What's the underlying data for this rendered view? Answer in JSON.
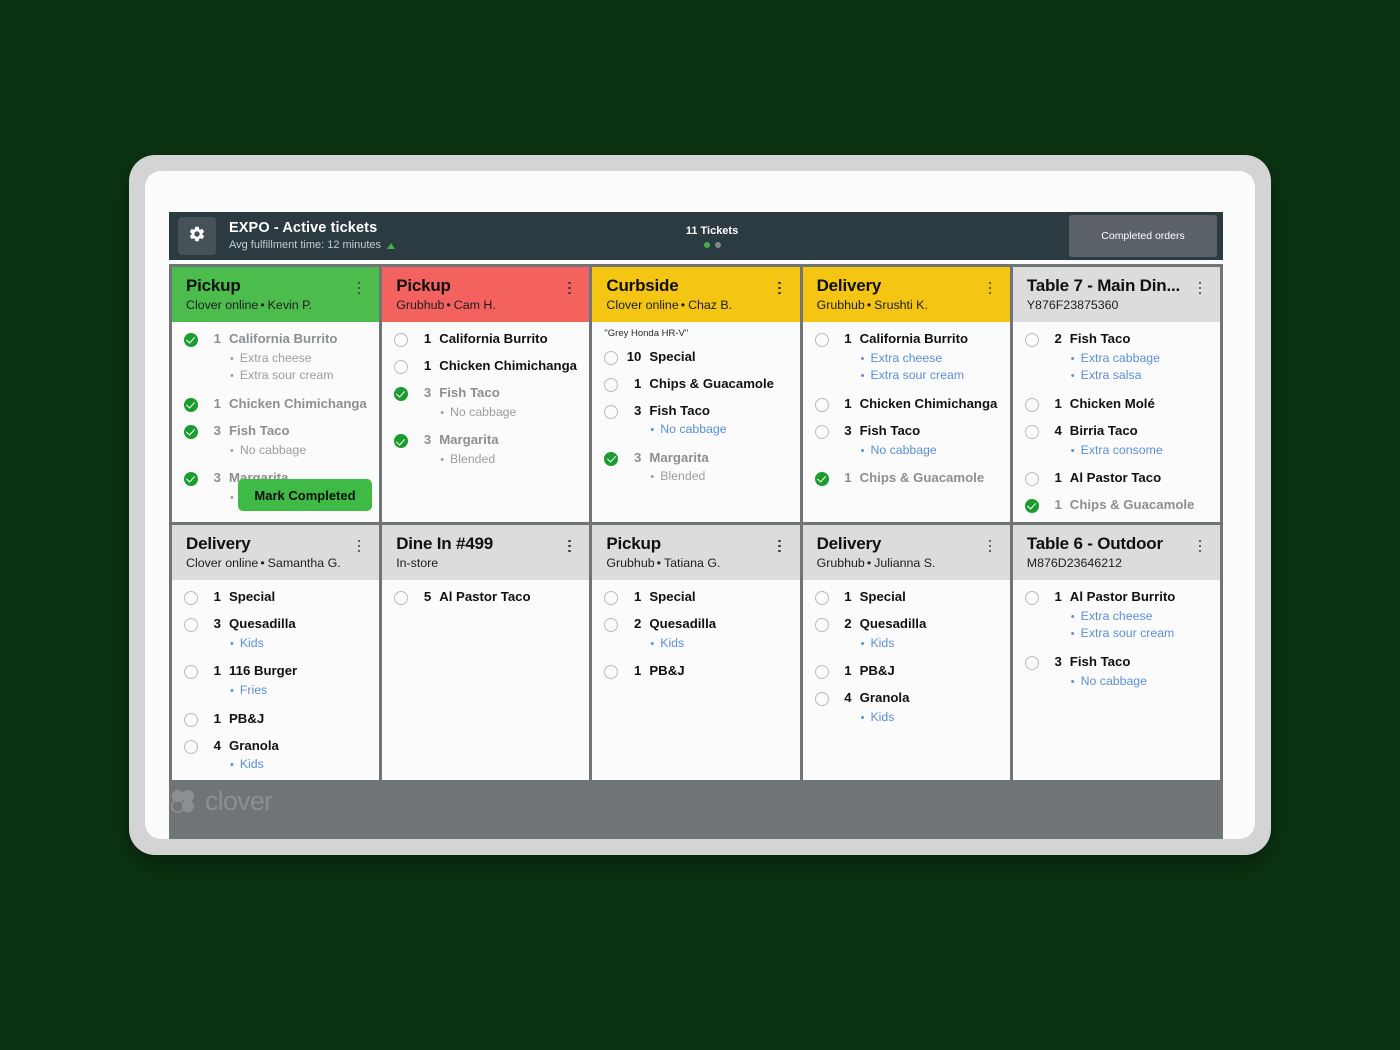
{
  "header": {
    "gear_icon": "gear-icon",
    "title": "EXPO - Active tickets",
    "subtitle": "Avg fulfillment time: 12 minutes",
    "trend_icon": "trend-up-icon",
    "ticket_count": "11 Tickets",
    "completed_button": "Completed orders",
    "colors": {
      "bar": "#2c3a42",
      "accent_green": "#3fb243",
      "button": "#5a6268"
    }
  },
  "footer": {
    "brand": "clover",
    "logo_icon": "clover-logo-icon"
  },
  "overlay": {
    "mark_completed": "Mark Completed"
  },
  "tickets": [
    {
      "type": "Pickup",
      "source": "Clover online",
      "customer": "Kevin P.",
      "header_color": "#4cbd4c",
      "header_class": "head-green",
      "note": null,
      "items": [
        {
          "qty": "1",
          "name": "California Burrito",
          "done": true,
          "mods": [
            "Extra cheese",
            "Extra sour cream"
          ]
        },
        {
          "qty": "1",
          "name": "Chicken Chimichanga",
          "done": true,
          "mods": []
        },
        {
          "qty": "3",
          "name": "Fish Taco",
          "done": true,
          "mods": [
            "No cabbage"
          ]
        },
        {
          "qty": "3",
          "name": "Margarita",
          "done": true,
          "mods": [
            "Blended"
          ]
        }
      ],
      "has_mark_completed": true
    },
    {
      "type": "Pickup",
      "source": "Grubhub",
      "customer": "Cam H.",
      "header_color": "#f4625f",
      "header_class": "head-red",
      "note": null,
      "items": [
        {
          "qty": "1",
          "name": "California Burrito",
          "done": false,
          "mods": []
        },
        {
          "qty": "1",
          "name": "Chicken Chimichanga",
          "done": false,
          "mods": []
        },
        {
          "qty": "3",
          "name": "Fish Taco",
          "done": true,
          "mods": [
            "No cabbage"
          ]
        },
        {
          "qty": "3",
          "name": "Margarita",
          "done": true,
          "mods": [
            "Blended"
          ]
        }
      ],
      "has_mark_completed": false
    },
    {
      "type": "Curbside",
      "source": "Clover online",
      "customer": "Chaz B.",
      "header_color": "#f4c613",
      "header_class": "head-yellow",
      "note": "\"Grey Honda HR-V\"",
      "items": [
        {
          "qty": "10",
          "name": "Special",
          "done": false,
          "mods": []
        },
        {
          "qty": "1",
          "name": "Chips & Guacamole",
          "done": false,
          "mods": []
        },
        {
          "qty": "3",
          "name": "Fish Taco",
          "done": false,
          "mods": [
            "No cabbage"
          ]
        },
        {
          "qty": "3",
          "name": "Margarita",
          "done": true,
          "mods": [
            "Blended"
          ]
        }
      ],
      "has_mark_completed": false
    },
    {
      "type": "Delivery",
      "source": "Grubhub",
      "customer": "Srushti K.",
      "header_color": "#f4c613",
      "header_class": "head-yellow",
      "note": null,
      "items": [
        {
          "qty": "1",
          "name": "California Burrito",
          "done": false,
          "mods": [
            "Extra cheese",
            "Extra sour cream"
          ]
        },
        {
          "qty": "1",
          "name": "Chicken Chimichanga",
          "done": false,
          "mods": []
        },
        {
          "qty": "3",
          "name": "Fish Taco",
          "done": false,
          "mods": [
            "No cabbage"
          ]
        },
        {
          "qty": "1",
          "name": "Chips & Guacamole",
          "done": true,
          "mods": []
        }
      ],
      "has_mark_completed": false
    },
    {
      "type": "Table 7 - Main Din...",
      "source": "Y876F23875360",
      "customer": null,
      "header_color": "#dcdcdc",
      "header_class": "head-grey",
      "note": null,
      "items": [
        {
          "qty": "2",
          "name": "Fish Taco",
          "done": false,
          "mods": [
            "Extra cabbage",
            "Extra salsa"
          ]
        },
        {
          "qty": "1",
          "name": "Chicken Molé",
          "done": false,
          "mods": []
        },
        {
          "qty": "4",
          "name": "Birria Taco",
          "done": false,
          "mods": [
            "Extra consome"
          ]
        },
        {
          "qty": "1",
          "name": "Al Pastor Taco",
          "done": false,
          "mods": []
        },
        {
          "qty": "1",
          "name": "Chips & Guacamole",
          "done": true,
          "mods": []
        }
      ],
      "has_mark_completed": false
    },
    {
      "type": "Delivery",
      "source": "Clover online",
      "customer": "Samantha G.",
      "header_color": "#dcdcdc",
      "header_class": "head-grey",
      "note": null,
      "items": [
        {
          "qty": "1",
          "name": "Special",
          "done": false,
          "mods": []
        },
        {
          "qty": "3",
          "name": "Quesadilla",
          "done": false,
          "mods": [
            "Kids"
          ]
        },
        {
          "qty": "1",
          "name": "116 Burger",
          "done": false,
          "mods": [
            "Fries"
          ]
        },
        {
          "qty": "1",
          "name": "PB&J",
          "done": false,
          "mods": []
        },
        {
          "qty": "4",
          "name": "Granola",
          "done": false,
          "mods": [
            "Kids"
          ]
        }
      ],
      "has_mark_completed": false
    },
    {
      "type": "Dine In #499",
      "source": "In-store",
      "customer": null,
      "header_color": "#dcdcdc",
      "header_class": "head-grey",
      "note": null,
      "items": [
        {
          "qty": "5",
          "name": "Al Pastor Taco",
          "done": false,
          "mods": []
        }
      ],
      "has_mark_completed": false
    },
    {
      "type": "Pickup",
      "source": "Grubhub",
      "customer": "Tatiana G.",
      "header_color": "#dcdcdc",
      "header_class": "head-grey",
      "note": null,
      "items": [
        {
          "qty": "1",
          "name": "Special",
          "done": false,
          "mods": []
        },
        {
          "qty": "2",
          "name": "Quesadilla",
          "done": false,
          "mods": [
            "Kids"
          ]
        },
        {
          "qty": "1",
          "name": "PB&J",
          "done": false,
          "mods": []
        }
      ],
      "has_mark_completed": false
    },
    {
      "type": "Delivery",
      "source": "Grubhub",
      "customer": "Julianna S.",
      "header_color": "#dcdcdc",
      "header_class": "head-grey",
      "note": null,
      "items": [
        {
          "qty": "1",
          "name": "Special",
          "done": false,
          "mods": []
        },
        {
          "qty": "2",
          "name": "Quesadilla",
          "done": false,
          "mods": [
            "Kids"
          ]
        },
        {
          "qty": "1",
          "name": "PB&J",
          "done": false,
          "mods": []
        },
        {
          "qty": "4",
          "name": "Granola",
          "done": false,
          "mods": [
            "Kids"
          ]
        }
      ],
      "has_mark_completed": false
    },
    {
      "type": "Table 6 - Outdoor",
      "source": "M876D23646212",
      "customer": null,
      "header_color": "#dcdcdc",
      "header_class": "head-grey",
      "note": null,
      "items": [
        {
          "qty": "1",
          "name": "Al Pastor Burrito",
          "done": false,
          "mods": [
            "Extra cheese",
            "Extra sour cream"
          ]
        },
        {
          "qty": "3",
          "name": "Fish Taco",
          "done": false,
          "mods": [
            "No cabbage"
          ]
        }
      ],
      "has_mark_completed": false
    }
  ]
}
